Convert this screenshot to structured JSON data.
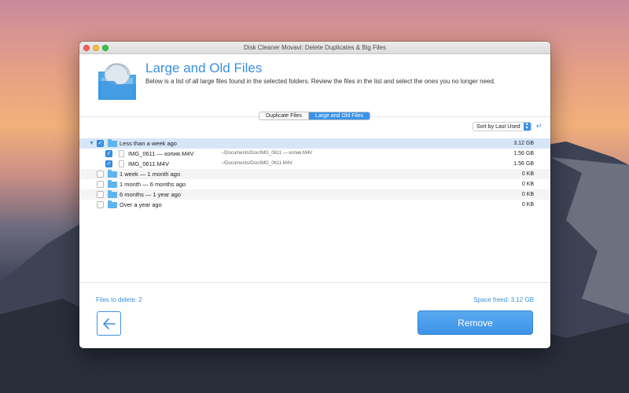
{
  "window": {
    "title": "Disk Cleaner Movavi: Delete Duplicates & Big Files"
  },
  "header": {
    "title": "Large and Old Files",
    "description": "Below is a list of all large files found in the selected folders. Review the files in the list and select the ones you no longer need."
  },
  "tabs": [
    {
      "label": "Duplicate Files",
      "active": false
    },
    {
      "label": "Large and Old Files",
      "active": true
    }
  ],
  "sort": {
    "selected": "Sort by Last Used"
  },
  "rows": [
    {
      "label": "Less than a week ago",
      "size": "3.12 GB",
      "checked": true,
      "kind": "group"
    },
    {
      "label": "IMG_0611 — копия.M4V",
      "path": "~/Documents/Doc/IMG_0611 — копия.M4V",
      "size": "1.56 GB",
      "checked": true,
      "kind": "file"
    },
    {
      "label": "IMG_0611.M4V",
      "path": "~/Documents/Doc/IMG_0611.M4V",
      "size": "1.56 GB",
      "checked": true,
      "kind": "file"
    },
    {
      "label": "1 week — 1 month ago",
      "size": "0 KB",
      "checked": false,
      "kind": "group"
    },
    {
      "label": "1 month — 6 months ago",
      "size": "0 KB",
      "checked": false,
      "kind": "group"
    },
    {
      "label": "6 months — 1 year ago",
      "size": "0 KB",
      "checked": false,
      "kind": "group"
    },
    {
      "label": "Over a year ago",
      "size": "0 KB",
      "checked": false,
      "kind": "group"
    }
  ],
  "footer": {
    "files_to_delete": "Files to delete: 2",
    "space_freed": "Space freed: 3.12 GB"
  },
  "actions": {
    "back_icon": "arrow-left-icon",
    "remove_label": "Remove"
  },
  "colors": {
    "accent": "#3c92e6",
    "folder": "#5fb4ee",
    "selection": "#d6e6f8"
  }
}
